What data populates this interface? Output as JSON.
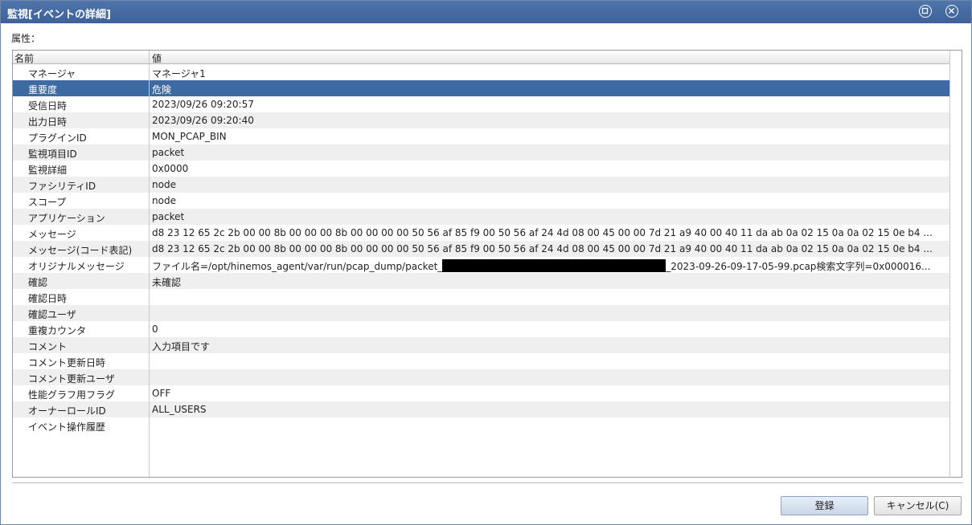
{
  "window": {
    "title": "監視[イベントの詳細]"
  },
  "attributes_label": "属性：",
  "table": {
    "headers": {
      "name": "名前",
      "value": "値"
    },
    "rows": [
      {
        "name": "マネージャ",
        "value": "マネージャ1"
      },
      {
        "name": "重要度",
        "value": "危険",
        "selected": true
      },
      {
        "name": "受信日時",
        "value": "2023/09/26 09:20:57"
      },
      {
        "name": "出力日時",
        "value": "2023/09/26 09:20:40"
      },
      {
        "name": "プラグインID",
        "value": "MON_PCAP_BIN"
      },
      {
        "name": "監視項目ID",
        "value": "packet"
      },
      {
        "name": "監視詳細",
        "value": "0x0000"
      },
      {
        "name": "ファシリティID",
        "value": "node"
      },
      {
        "name": "スコープ",
        "value": "node"
      },
      {
        "name": "アプリケーション",
        "value": "packet"
      },
      {
        "name": "メッセージ",
        "value": "d8 23 12 65 2c 2b 00 00 8b 00 00 00 8b 00 00 00 00 50 56 af 85 f9 00 50 56 af 24 4d 08 00 45 00 00 7d 21 a9 40 00 40 11 da ab 0a 02 15 0a 0a 02 15 0e b4 ..."
      },
      {
        "name": "メッセージ(コード表記)",
        "value": "d8 23 12 65 2c 2b 00 00 8b 00 00 00 8b 00 00 00 00 50 56 af 85 f9 00 50 56 af 24 4d 08 00 45 00 00 7d 21 a9 40 00 40 11 da ab 0a 02 15 0a 0a 02 15 0e b4 ..."
      },
      {
        "name": "オリジナルメッセージ",
        "value_prefix": "ファイル名=/opt/hinemos_agent/var/run/pcap_dump/packet_",
        "value_suffix": "_2023-09-26-09-17-05-99.pcap検索文字列=0x000016..."
      },
      {
        "name": "確認",
        "value": "未確認"
      },
      {
        "name": "確認日時",
        "value": ""
      },
      {
        "name": "確認ユーザ",
        "value": ""
      },
      {
        "name": "重複カウンタ",
        "value": "0"
      },
      {
        "name": "コメント",
        "value": "入力項目です"
      },
      {
        "name": "コメント更新日時",
        "value": ""
      },
      {
        "name": "コメント更新ユーザ",
        "value": ""
      },
      {
        "name": "性能グラフ用フラグ",
        "value": "OFF"
      },
      {
        "name": "オーナーロールID",
        "value": "ALL_USERS"
      },
      {
        "name": "イベント操作履歴",
        "value": ""
      }
    ]
  },
  "buttons": {
    "register": "登録",
    "cancel": "キャンセル(C)"
  }
}
